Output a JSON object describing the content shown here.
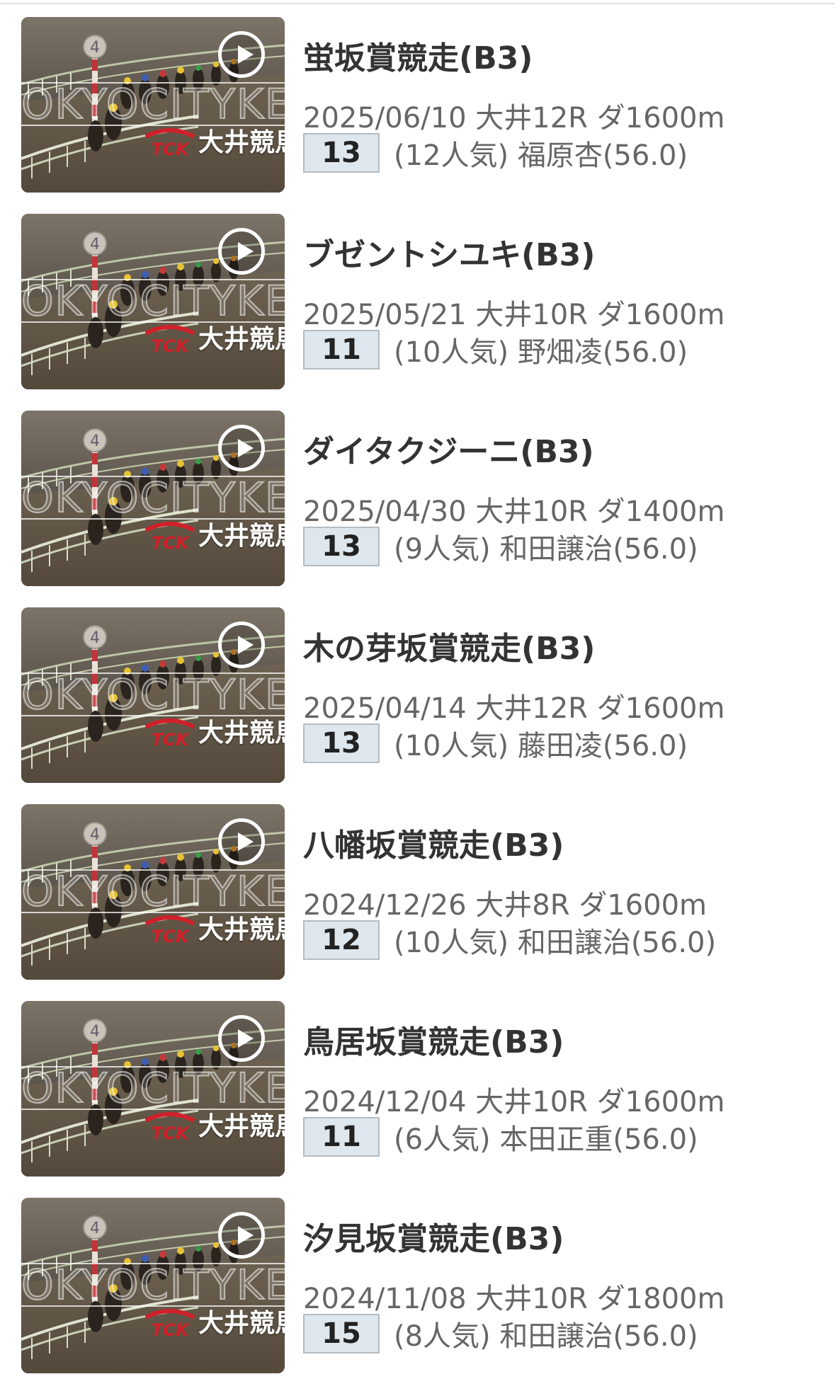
{
  "races": [
    {
      "name": "蛍坂賞競走(B3)",
      "meta": "2025/06/10 大井12R ダ1600m",
      "place": "13",
      "detail": "(12人気) 福原杏(56.0)"
    },
    {
      "name": "ブゼントシユキ(B3)",
      "meta": "2025/05/21 大井10R ダ1600m",
      "place": "11",
      "detail": "(10人気) 野畑凌(56.0)"
    },
    {
      "name": "ダイタクジーニ(B3)",
      "meta": "2025/04/30 大井10R ダ1400m",
      "place": "13",
      "detail": "(9人気) 和田譲治(56.0)"
    },
    {
      "name": "木の芽坂賞競走(B3)",
      "meta": "2025/04/14 大井12R ダ1600m",
      "place": "13",
      "detail": "(10人気) 藤田凌(56.0)"
    },
    {
      "name": "八幡坂賞競走(B3)",
      "meta": "2024/12/26 大井8R ダ1600m",
      "place": "12",
      "detail": "(10人気) 和田譲治(56.0)"
    },
    {
      "name": "鳥居坂賞競走(B3)",
      "meta": "2024/12/04 大井10R ダ1600m",
      "place": "11",
      "detail": "(6人気) 本田正重(56.0)"
    },
    {
      "name": "汐見坂賞競走(B3)",
      "meta": "2024/11/08 大井10R ダ1800m",
      "place": "15",
      "detail": "(8人気) 和田譲治(56.0)"
    }
  ],
  "thumbnail": {
    "watermark": "OKYOCITYKEIBA",
    "track_label": "大井競馬",
    "pole_number": "4",
    "logo_text": "TCK"
  },
  "colors": {
    "badge_bg": "#dfe7ee",
    "title": "#333333",
    "meta": "#666666",
    "logo_red": "#d0202a"
  },
  "icons": {
    "play": "play-circle-icon",
    "logo": "tck-logo-icon"
  }
}
